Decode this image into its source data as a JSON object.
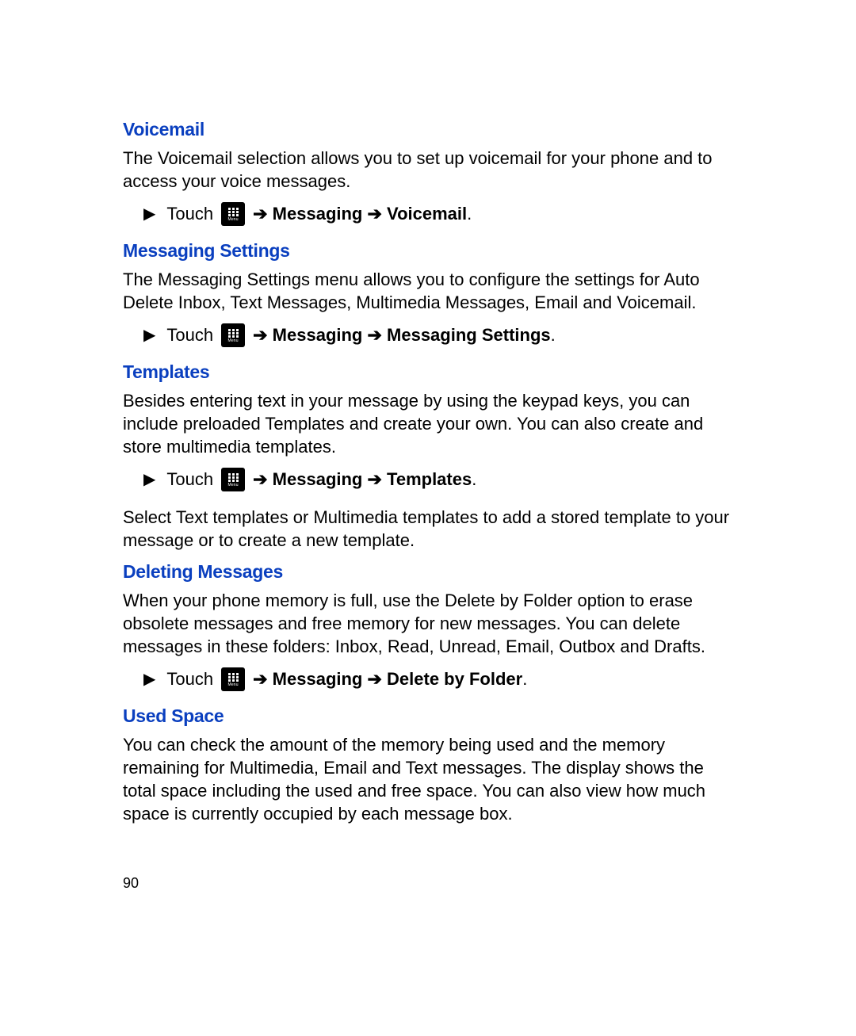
{
  "page_number": "90",
  "sections": {
    "voicemail": {
      "heading": "Voicemail",
      "body": "The Voicemail selection allows you to set up voicemail for your phone and to access your voice messages.",
      "step_touch": "Touch",
      "step_arrow1": "➔",
      "step_bold": "Messaging ➔ Voicemail",
      "period": "."
    },
    "messaging_settings": {
      "heading": "Messaging Settings",
      "body": "The Messaging Settings menu allows you to configure the settings for Auto Delete Inbox, Text Messages, Multimedia Messages, Email and Voicemail.",
      "step_touch": "Touch",
      "step_arrow1": "➔",
      "step_bold": "Messaging ➔ Messaging Settings",
      "period": "."
    },
    "templates": {
      "heading": "Templates",
      "body": "Besides entering text in your message by using the keypad keys, you can include preloaded Templates and create your own. You can also create and store multimedia templates.",
      "step_touch": "Touch",
      "step_arrow1": "➔",
      "step_bold": "Messaging ➔ Templates",
      "period": ".",
      "body2": "Select Text templates or Multimedia templates to add a stored template to your message or to create a new template."
    },
    "deleting_messages": {
      "heading": "Deleting Messages",
      "body": "When your phone memory is full, use the Delete by Folder option to erase obsolete messages and free memory for new messages. You can delete messages in these folders: Inbox, Read, Unread, Email, Outbox and Drafts.",
      "step_touch": "Touch",
      "step_arrow1": "➔",
      "step_bold": "Messaging ➔ Delete by Folder",
      "period": "."
    },
    "used_space": {
      "heading": "Used Space",
      "body": "You can check the amount of the memory being used and the memory remaining for Multimedia, Email and Text messages. The display shows the total space including the used and free space. You can also view how much space is currently occupied by each message box."
    }
  },
  "menu_icon_label": "Menu"
}
